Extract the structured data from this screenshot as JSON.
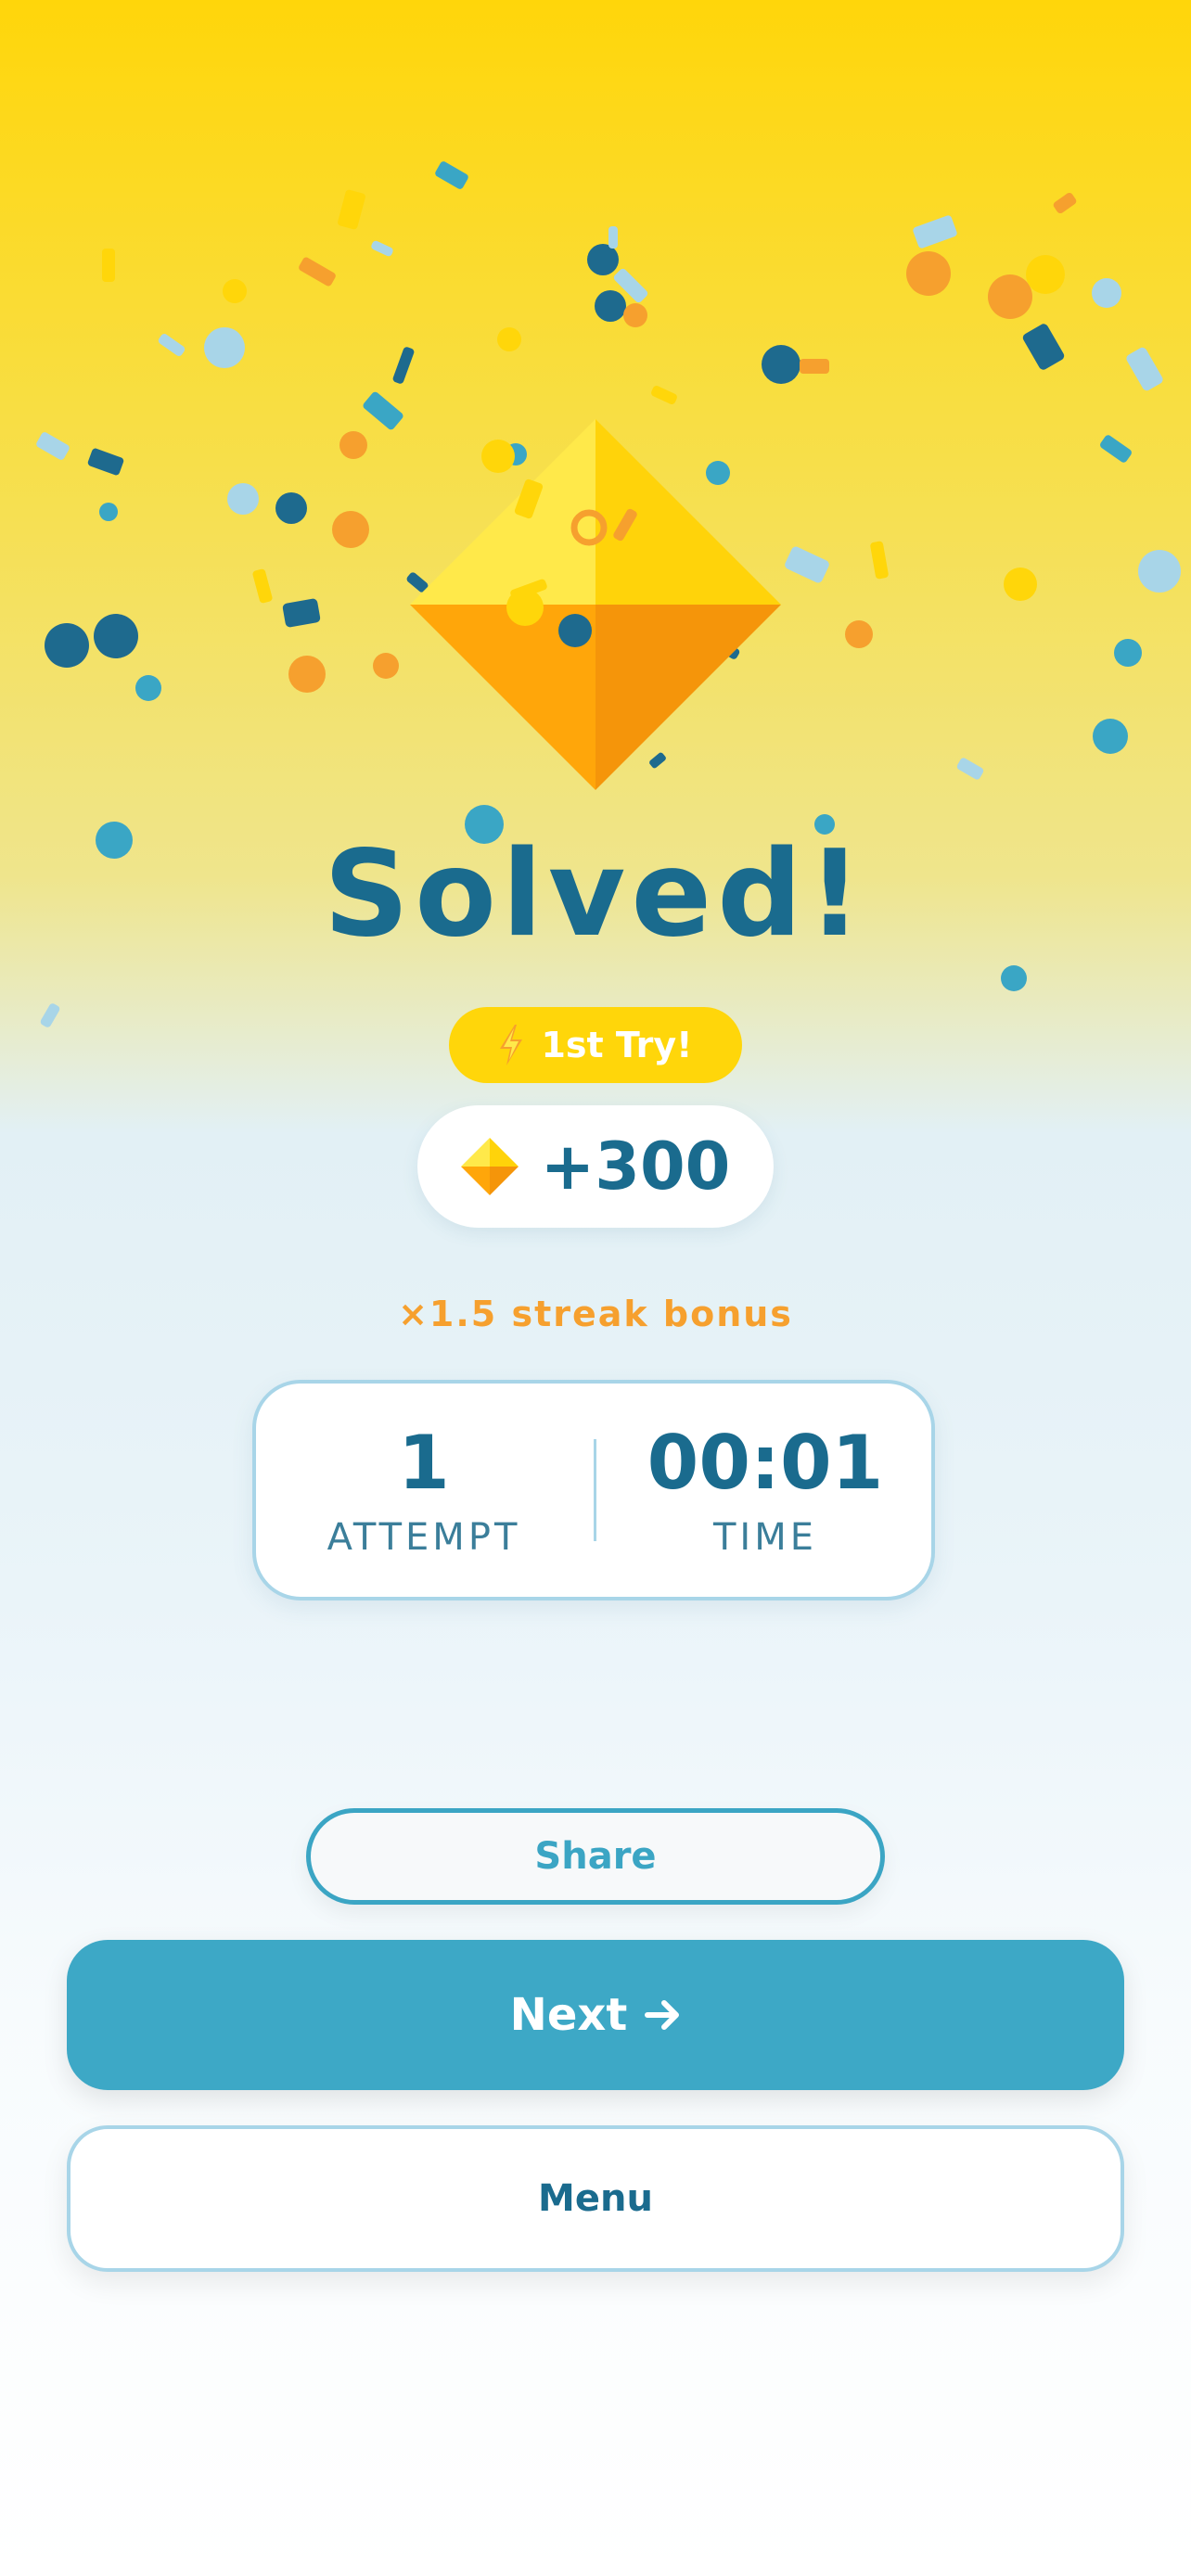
{
  "title": "Solved!",
  "badge": {
    "icon": "lightning-bolt-icon",
    "label": "1st Try!"
  },
  "reward": {
    "icon": "gem-icon",
    "amount": "+300"
  },
  "streak_bonus": "×1.5 streak bonus",
  "stats": [
    {
      "value": "1",
      "label": "ATTEMPT"
    },
    {
      "value": "00:01",
      "label": "TIME"
    }
  ],
  "buttons": {
    "share": "Share",
    "next": "Next",
    "menu": "Menu"
  },
  "colors": {
    "accent_yellow": "#FFD60A",
    "primary_blue": "#3DA8C6",
    "dark_blue": "#1A6B8E",
    "orange": "#F6A02E",
    "light_blue": "#A8D5E8"
  }
}
